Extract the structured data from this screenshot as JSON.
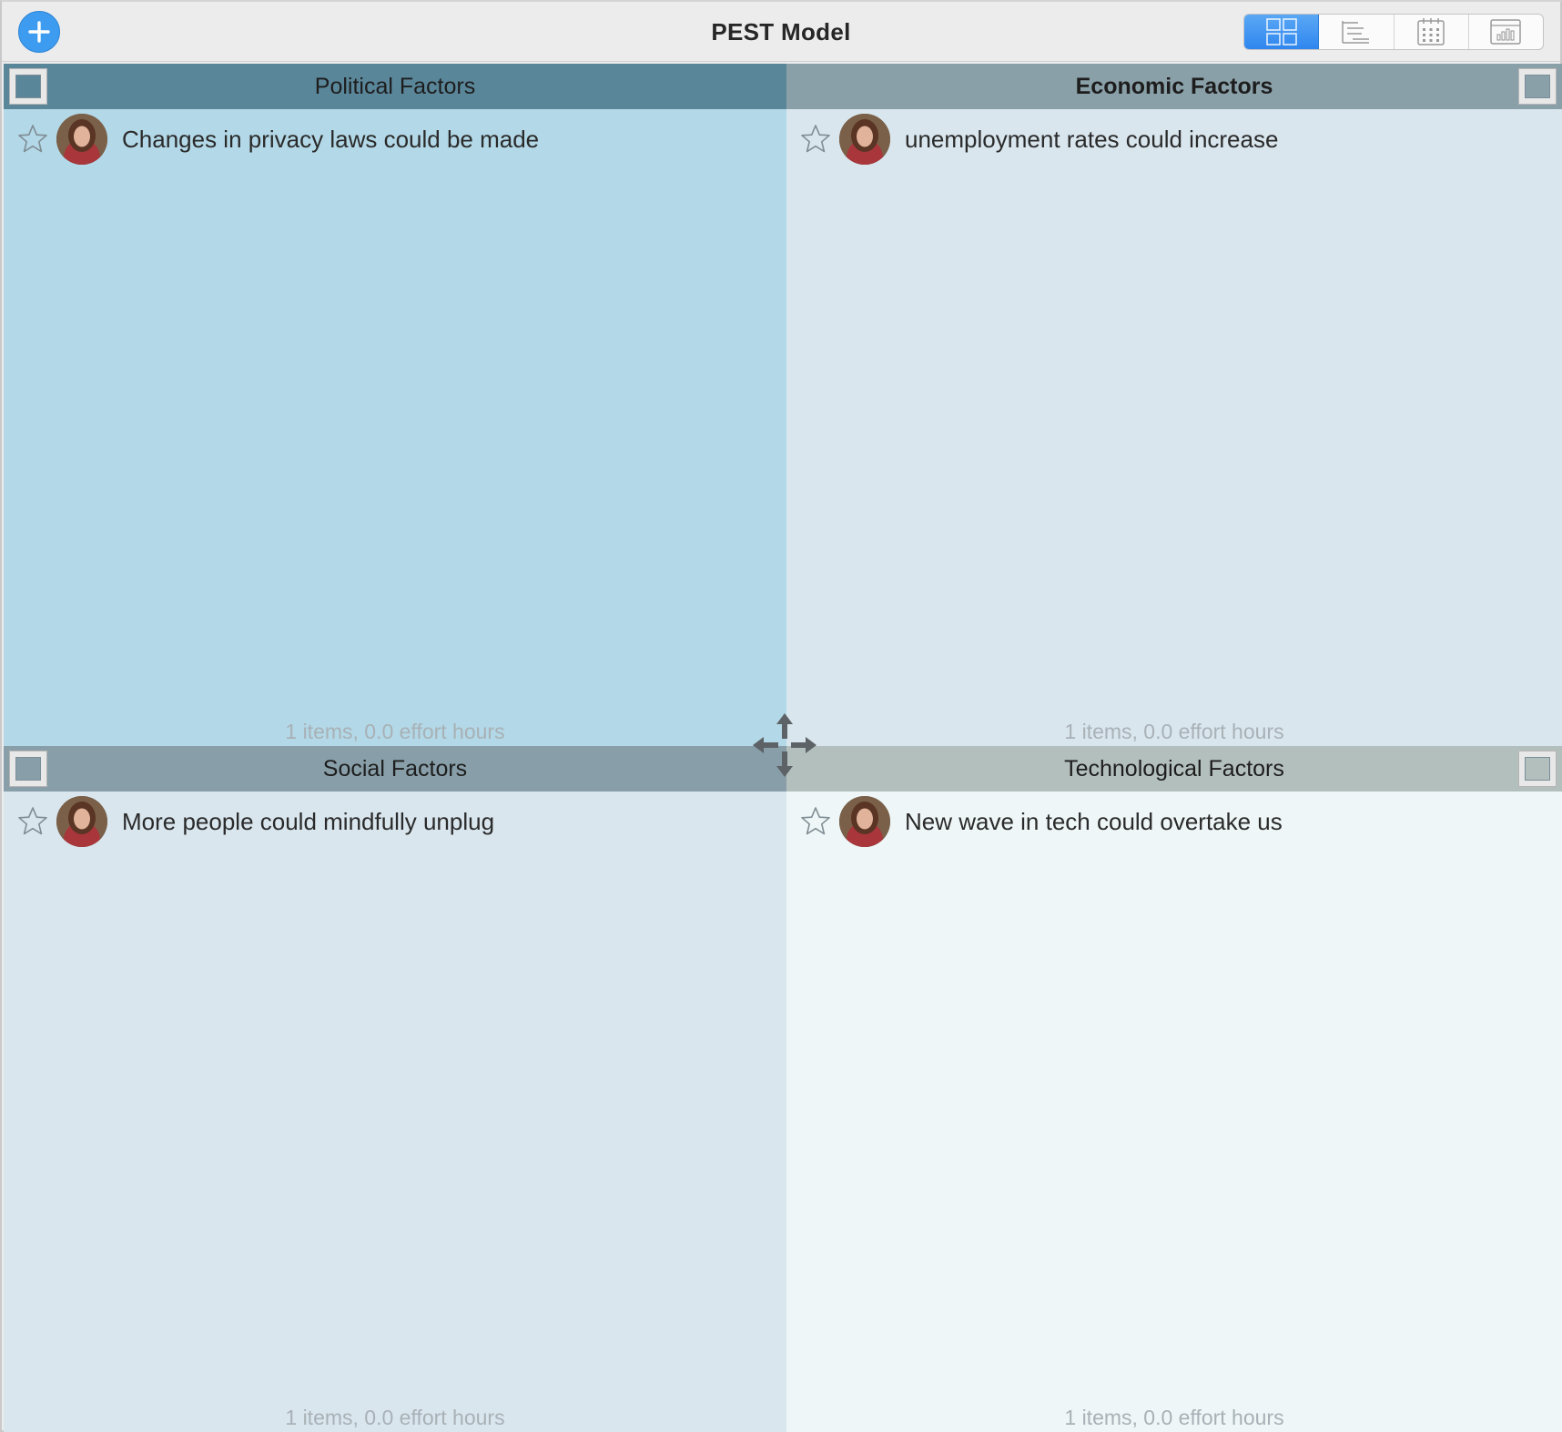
{
  "window": {
    "title": "PEST Model"
  },
  "toolbar": {
    "add_icon": "plus-circle-icon",
    "views": [
      {
        "name": "grid-view",
        "icon": "grid-icon",
        "active": true
      },
      {
        "name": "outline-view",
        "icon": "outline-icon",
        "active": false
      },
      {
        "name": "calendar-view",
        "icon": "calendar-icon",
        "active": false
      },
      {
        "name": "chart-view",
        "icon": "chart-icon",
        "active": false
      }
    ]
  },
  "quadrants": {
    "political": {
      "title": "Political Factors",
      "color": "#5a869a",
      "items": [
        {
          "text": "Changes in privacy laws could be made",
          "starred": false
        }
      ],
      "footer": "1 items, 0.0 effort hours"
    },
    "economic": {
      "title": "Economic Factors",
      "color": "#8aa0a9",
      "items": [
        {
          "text": "unemployment rates could increase",
          "starred": false
        }
      ],
      "footer": "1 items, 0.0 effort hours"
    },
    "social": {
      "title": "Social Factors",
      "color": "#889fa9",
      "items": [
        {
          "text": "More people could mindfully unplug",
          "starred": false
        }
      ],
      "footer": "1 items, 0.0 effort hours"
    },
    "technological": {
      "title": "Technological Factors",
      "color": "#b3bfbc",
      "items": [
        {
          "text": "New wave in tech could overtake us",
          "starred": false
        }
      ],
      "footer": "1 items, 0.0 effort hours"
    }
  },
  "colors": {
    "accent": "#3d9cf0",
    "political_bg": "#b3d8e7",
    "economic_bg": "#d9e6ee",
    "social_bg": "#d9e6ee",
    "technological_bg": "#eef6f7"
  }
}
